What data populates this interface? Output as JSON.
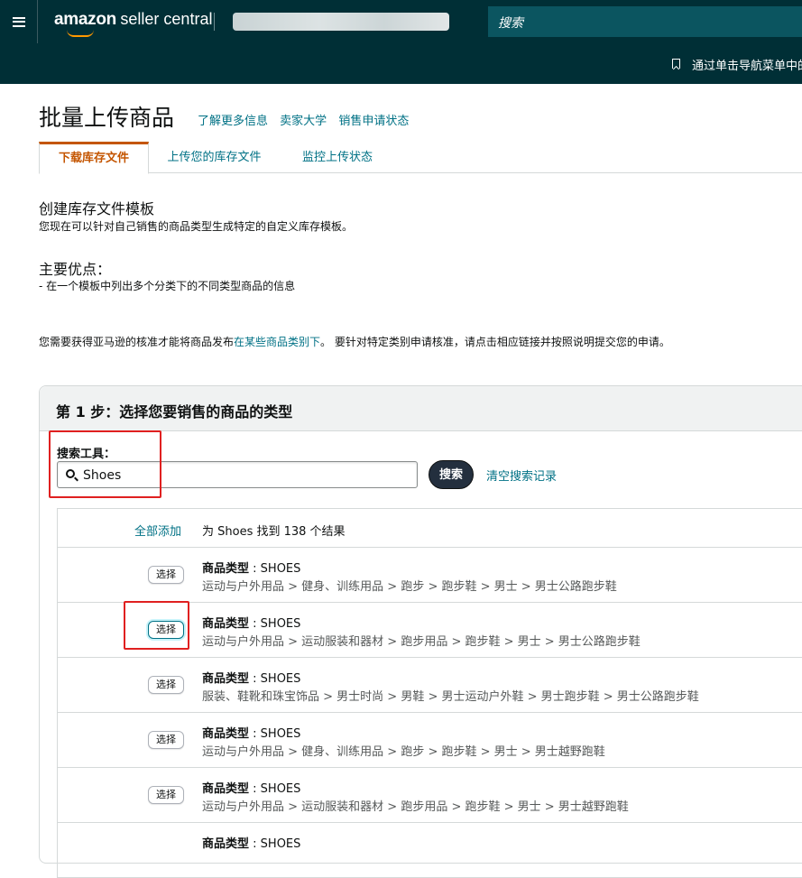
{
  "header": {
    "brand": "amazon",
    "product": "seller central",
    "search_placeholder": "搜索",
    "nav_hint": "通过单击导航菜单中的"
  },
  "page": {
    "title": "批量上传商品",
    "links": [
      "了解更多信息",
      "卖家大学",
      "销售申请状态"
    ],
    "tabs": [
      "下载库存文件",
      "上传您的库存文件",
      "监控上传状态"
    ]
  },
  "sections": {
    "create_title": "创建库存文件模板",
    "create_desc": "您现在可以针对自己销售的商品类型生成特定的自定义库存模板。",
    "benefit_title": "主要优点：",
    "benefit_desc": "- 在一个模板中列出多个分类下的不同类型商品的信息",
    "approval_pre": "您需要获得亚马逊的核准才能将商品发布",
    "approval_link": "在某些商品类别下",
    "approval_post": "。 要针对特定类别申请核准，请点击相应链接并按照说明提交您的申请。"
  },
  "step": {
    "title": "第 1 步：选择您要销售的商品的类型",
    "search_label": "搜索工具：",
    "search_value": "Shoes",
    "search_button": "搜索",
    "clear_link": "清空搜索记录",
    "add_all": "全部添加",
    "result_count": "为 Shoes 找到 138 个结果",
    "select_label": "选择",
    "type_label": "商品类型",
    "results": [
      {
        "type": "SHOES",
        "path": "运动与户外用品 > 健身、训练用品 > 跑步 > 跑步鞋 > 男士 > 男士公路跑步鞋"
      },
      {
        "type": "SHOES",
        "path": "运动与户外用品 > 运动服装和器材 > 跑步用品 > 跑步鞋 > 男士 > 男士公路跑步鞋"
      },
      {
        "type": "SHOES",
        "path": "服装、鞋靴和珠宝饰品 > 男士时尚 > 男鞋 > 男士运动户外鞋 > 男士跑步鞋 > 男士公路跑步鞋"
      },
      {
        "type": "SHOES",
        "path": "运动与户外用品 > 健身、训练用品 > 跑步 > 跑步鞋 > 男士 > 男士越野跑鞋"
      },
      {
        "type": "SHOES",
        "path": "运动与户外用品 > 运动服装和器材 > 跑步用品 > 跑步鞋 > 男士 > 男士越野跑鞋"
      },
      {
        "type": "SHOES",
        "path": ""
      }
    ]
  },
  "colors": {
    "header_bg": "#002f36",
    "link": "#007185",
    "active_tab": "#c45500",
    "highlight": "#e02020"
  }
}
